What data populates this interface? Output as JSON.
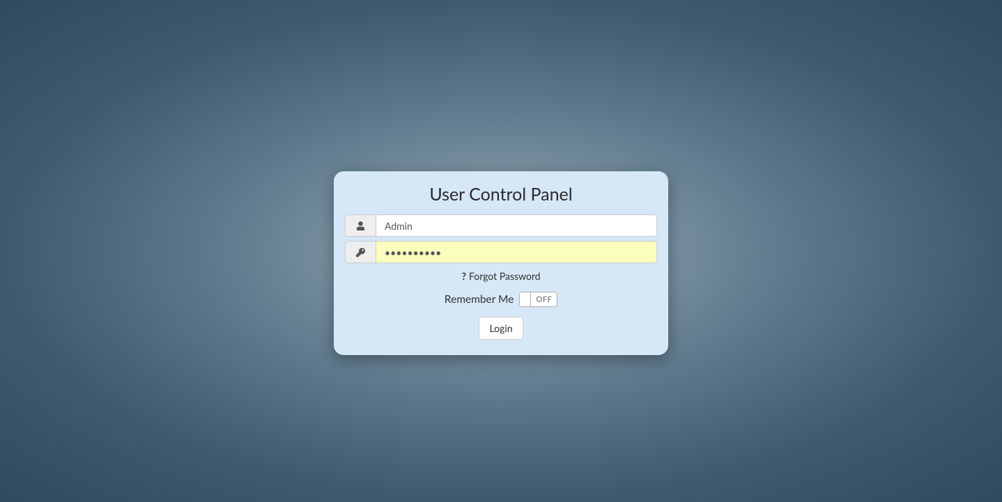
{
  "panel": {
    "title": "User Control Panel",
    "username_value": "Admin",
    "password_value": "••••••••••",
    "forgot_label": "Forgot Password",
    "remember_label": "Remember Me",
    "toggle_state": "OFF",
    "login_label": "Login"
  }
}
